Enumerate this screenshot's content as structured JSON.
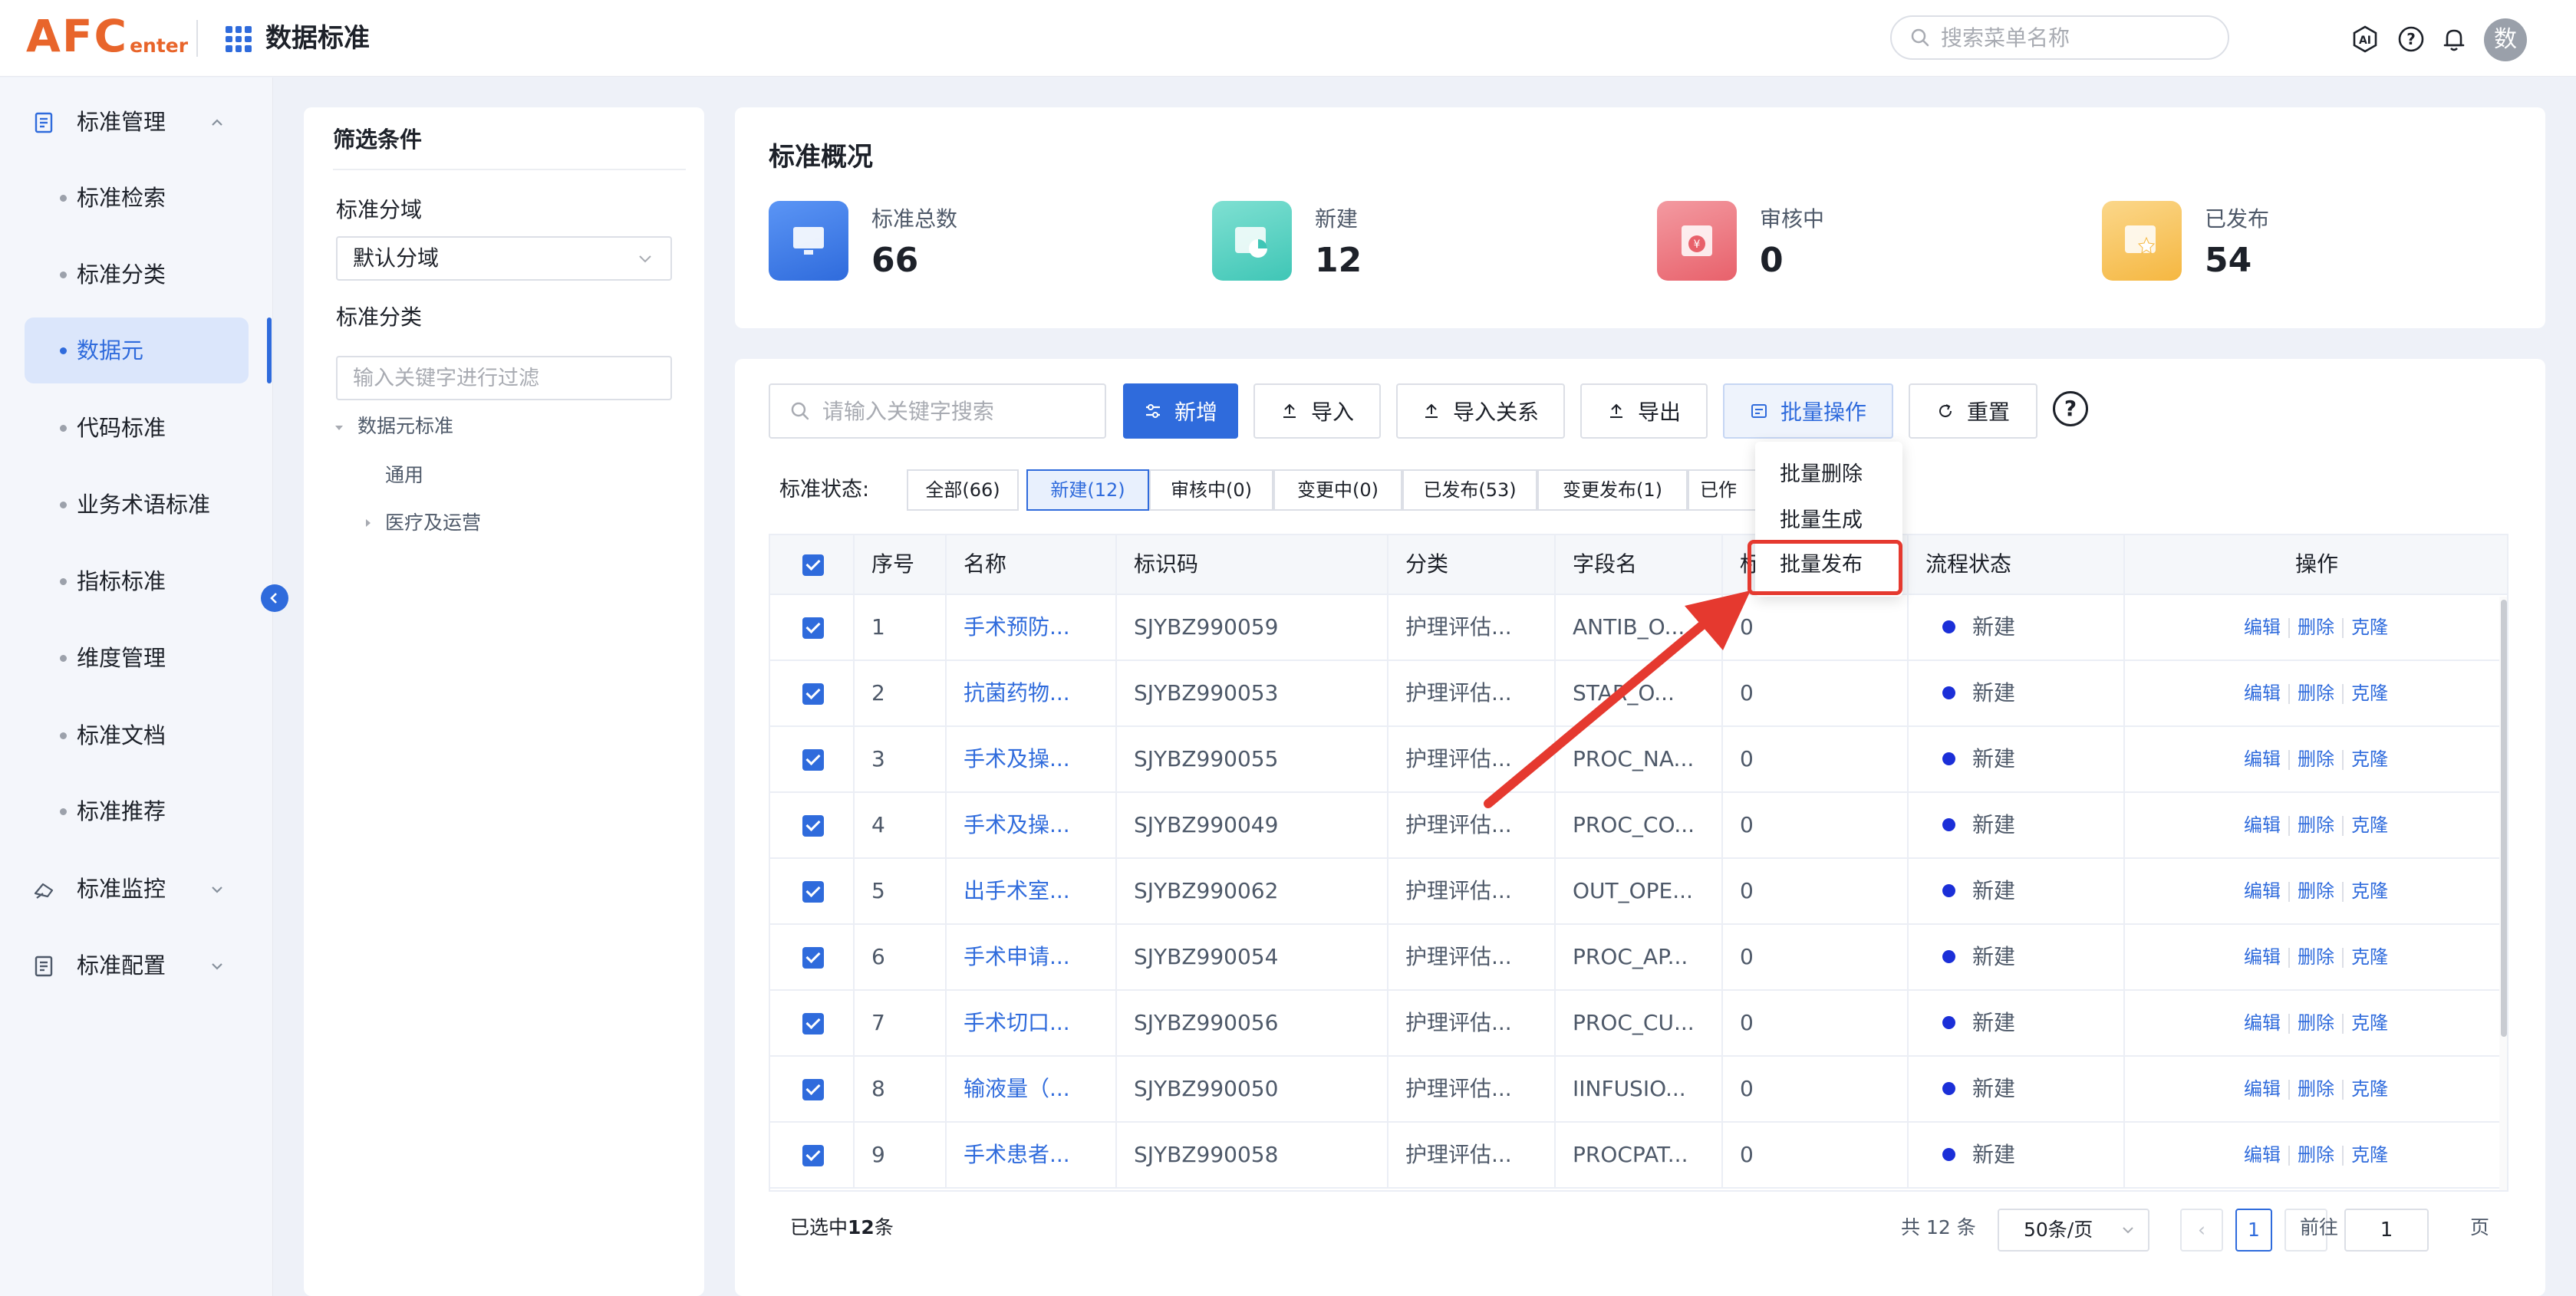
{
  "header": {
    "logo_main": "AFC",
    "logo_sub": "enter",
    "title": "数据标准",
    "search_placeholder": "搜索菜单名称",
    "avatar_text": "数"
  },
  "sidebar": {
    "groups": [
      {
        "label": "标准管理",
        "icon": "document-icon",
        "expanded": true
      },
      {
        "label": "标准监控",
        "icon": "monitor-icon",
        "expanded": false
      },
      {
        "label": "标准配置",
        "icon": "document-icon",
        "expanded": false
      }
    ],
    "items": [
      {
        "label": "标准检索"
      },
      {
        "label": "标准分类"
      },
      {
        "label": "数据元",
        "active": true
      },
      {
        "label": "代码标准"
      },
      {
        "label": "业务术语标准"
      },
      {
        "label": "指标标准"
      },
      {
        "label": "维度管理"
      },
      {
        "label": "标准文档"
      },
      {
        "label": "标准推荐"
      }
    ]
  },
  "filter": {
    "title": "筛选条件",
    "domain_label": "标准分域",
    "domain_value": "默认分域",
    "category_label": "标准分类",
    "keyword_placeholder": "输入关键字进行过滤",
    "tree": {
      "root": "数据元标准",
      "children": [
        "通用",
        "医疗及运营"
      ]
    }
  },
  "overview": {
    "title": "标准概况",
    "stats": [
      {
        "label": "标准总数",
        "value": "66",
        "color": "#2f6bdc"
      },
      {
        "label": "新建",
        "value": "12",
        "color": "#3fc6b6"
      },
      {
        "label": "审核中",
        "value": "0",
        "color": "#e8616b"
      },
      {
        "label": "已发布",
        "value": "54",
        "color": "#f5b741"
      }
    ]
  },
  "toolbar": {
    "search_placeholder": "请输入关键字搜索",
    "add": "新增",
    "import": "导入",
    "import_relation": "导入关系",
    "export": "导出",
    "batch": "批量操作",
    "reset": "重置",
    "help": "?"
  },
  "batch_menu": [
    "批量删除",
    "批量生成",
    "批量发布"
  ],
  "status_filter": {
    "label": "标准状态:",
    "options": [
      "全部(66)",
      "新建(12)",
      "审核中(0)",
      "变更中(0)",
      "已发布(53)",
      "变更发布(1)",
      "已作"
    ],
    "active_index": 1
  },
  "table": {
    "columns": [
      "序号",
      "名称",
      "标识码",
      "分类",
      "字段名",
      "标",
      "流程状态",
      "操作"
    ],
    "rows": [
      {
        "no": "1",
        "name": "手术预防...",
        "code": "SJYBZ990059",
        "category": "护理评估...",
        "field": "ANTIB_O...",
        "std": "0",
        "status": "新建"
      },
      {
        "no": "2",
        "name": "抗菌药物...",
        "code": "SJYBZ990053",
        "category": "护理评估...",
        "field": "STAR_O...",
        "std": "0",
        "status": "新建"
      },
      {
        "no": "3",
        "name": "手术及操...",
        "code": "SJYBZ990055",
        "category": "护理评估...",
        "field": "PROC_NA...",
        "std": "0",
        "status": "新建"
      },
      {
        "no": "4",
        "name": "手术及操...",
        "code": "SJYBZ990049",
        "category": "护理评估...",
        "field": "PROC_CO...",
        "std": "0",
        "status": "新建"
      },
      {
        "no": "5",
        "name": "出手术室...",
        "code": "SJYBZ990062",
        "category": "护理评估...",
        "field": "OUT_OPE...",
        "std": "0",
        "status": "新建"
      },
      {
        "no": "6",
        "name": "手术申请...",
        "code": "SJYBZ990054",
        "category": "护理评估...",
        "field": "PROC_AP...",
        "std": "0",
        "status": "新建"
      },
      {
        "no": "7",
        "name": "手术切口...",
        "code": "SJYBZ990056",
        "category": "护理评估...",
        "field": "PROC_CU...",
        "std": "0",
        "status": "新建"
      },
      {
        "no": "8",
        "name": "输液量（...",
        "code": "SJYBZ990050",
        "category": "护理评估...",
        "field": "IINFUSIO...",
        "std": "0",
        "status": "新建"
      },
      {
        "no": "9",
        "name": "手术患者...",
        "code": "SJYBZ990058",
        "category": "护理评估...",
        "field": "PROCPAT...",
        "std": "0",
        "status": "新建"
      }
    ],
    "ops": [
      "编辑",
      "删除",
      "克隆"
    ]
  },
  "footer": {
    "selected_prefix": "已选中",
    "selected_count": "12",
    "selected_suffix": "条",
    "total": "共 12 条",
    "page_size": "50条/页",
    "prev": "‹",
    "current_page": "1",
    "next": "›",
    "goto_prefix": "前往",
    "goto_value": "1",
    "goto_suffix": "页"
  },
  "colors": {
    "primary": "#2f6bdc",
    "annotation": "#e5392f",
    "status_dot": "#1b2fd8"
  }
}
